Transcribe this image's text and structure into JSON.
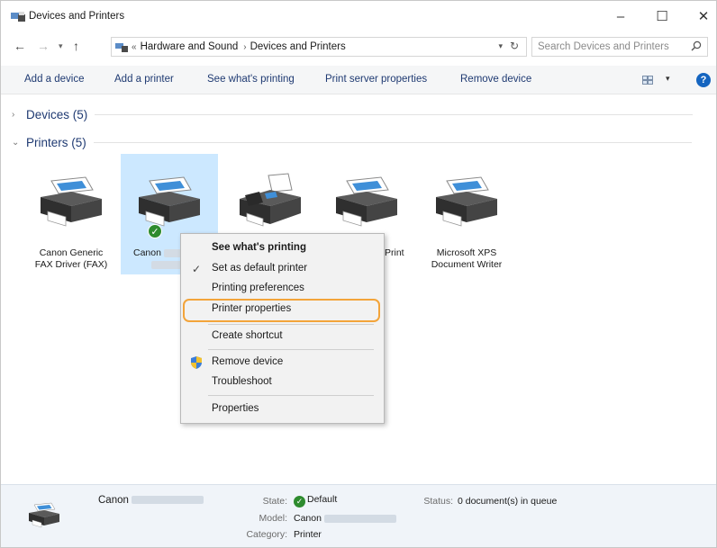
{
  "window": {
    "title": "Devices and Printers",
    "minimize_icon": "–",
    "maximize_icon": "☐",
    "close_icon": "✕"
  },
  "nav": {
    "back": "←",
    "forward": "→",
    "recent": "▾",
    "up": "↑",
    "breadcrumb": [
      "Hardware and Sound",
      "Devices and Printers"
    ],
    "crumb_prefix": "«",
    "crumb_sep": "›",
    "addr_dropdown": "▾",
    "refresh": "↻",
    "search_placeholder": "Search Devices and Printers"
  },
  "commands": {
    "add_device": "Add a device",
    "add_printer": "Add a printer",
    "see_printing": "See what's printing",
    "server_props": "Print server properties",
    "remove_device": "Remove device",
    "view_dropdown": "▾",
    "help": "?"
  },
  "groups": {
    "devices": {
      "chevron": "›",
      "label": "Devices (5)"
    },
    "printers": {
      "chevron": "⌄",
      "label": "Printers (5)"
    }
  },
  "printers": [
    {
      "line1": "Canon Generic",
      "line2": "FAX Driver (FAX)"
    },
    {
      "line1": "Canon",
      "line2": ""
    },
    {
      "line1": "",
      "line2": ""
    },
    {
      "line1": "Print",
      "line2": ""
    },
    {
      "line1": "Microsoft XPS",
      "line2": "Document Writer"
    }
  ],
  "default_badge": "✓",
  "context_menu": {
    "see_printing": "See what's printing",
    "set_default": "Set as default printer",
    "check_mark": "✓",
    "printing_prefs": "Printing preferences",
    "printer_props": "Printer properties",
    "create_shortcut": "Create shortcut",
    "remove_device": "Remove device",
    "troubleshoot": "Troubleshoot",
    "properties": "Properties"
  },
  "details": {
    "name": "Canon",
    "state_label": "State:",
    "state_value": "Default",
    "status_label": "Status:",
    "status_value": "0 document(s) in queue",
    "model_label": "Model:",
    "model_value": "Canon",
    "category_label": "Category:",
    "category_value": "Printer"
  },
  "colors": {
    "link": "#1f3a72",
    "selection": "#cce8ff",
    "highlight_ring": "#f3a43a",
    "check_green": "#2e8b2e",
    "help_blue": "#1565c0"
  }
}
